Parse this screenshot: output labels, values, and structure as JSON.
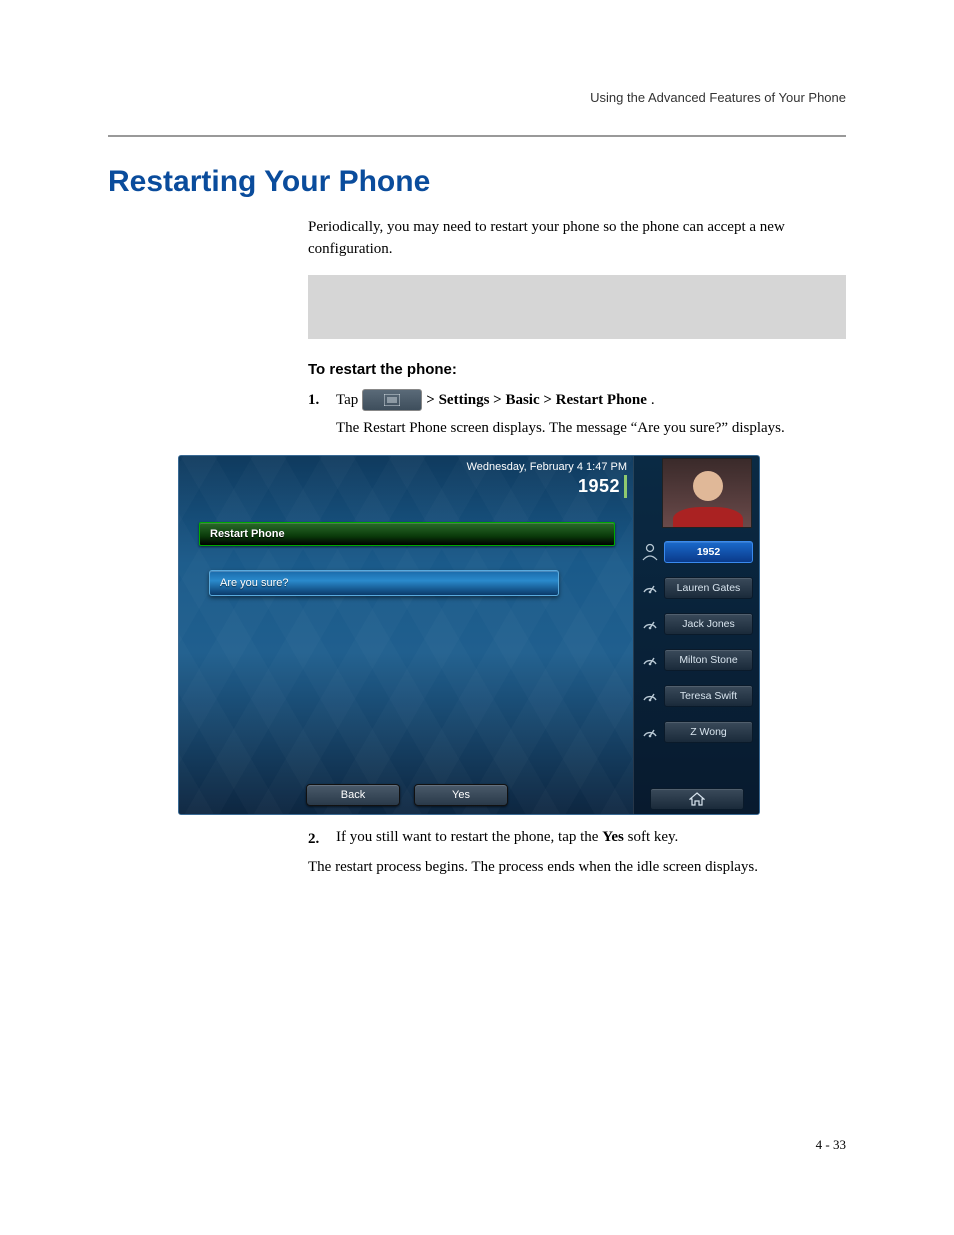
{
  "running_header": "Using the Advanced Features of Your Phone",
  "section_title": "Restarting Your Phone",
  "intro": "Periodically, you may need to restart your phone so the phone can accept a new configuration.",
  "steps_heading": "To restart the phone:",
  "step1": {
    "num": "1.",
    "pre": "Tap",
    "post": "> Settings > Basic > Restart Phone",
    "period": ".",
    "note": "The Restart Phone screen displays. The message “Are you sure?” displays."
  },
  "step2": {
    "num": "2.",
    "pre": "If you still want to restart the phone, tap the ",
    "bold": "Yes",
    "post": " soft key.",
    "note": "The restart process begins. The process ends when the idle screen displays."
  },
  "shot": {
    "datetime": "Wednesday, February 4  1:47 PM",
    "extension": "1952",
    "title": "Restart Phone",
    "prompt": "Are you sure?",
    "softkeys": {
      "back": "Back",
      "yes": "Yes"
    },
    "contacts": [
      {
        "label": "1952",
        "active": true
      },
      {
        "label": "Lauren Gates",
        "active": false
      },
      {
        "label": "Jack Jones",
        "active": false
      },
      {
        "label": "Milton Stone",
        "active": false
      },
      {
        "label": "Teresa Swift",
        "active": false
      },
      {
        "label": "Z Wong",
        "active": false
      }
    ]
  },
  "page_num": "4 - 33"
}
